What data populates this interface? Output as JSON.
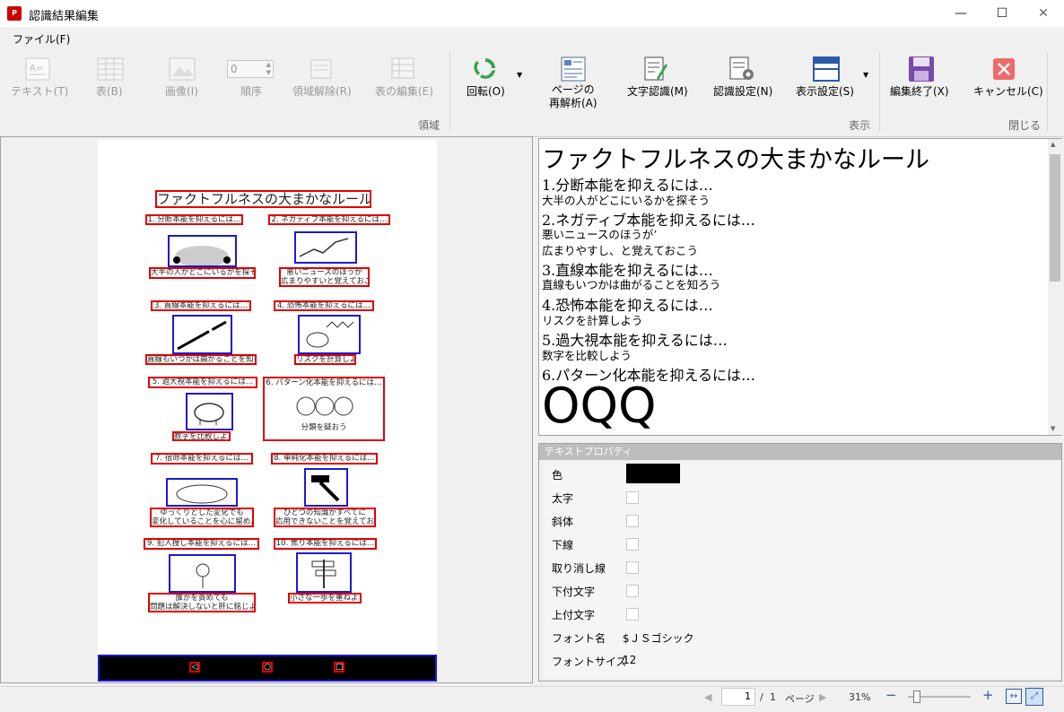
{
  "window": {
    "title": "認識結果編集",
    "minimize": "—",
    "maximize": "☐",
    "close": "✕"
  },
  "menu": {
    "file": "ファイル(F)"
  },
  "ribbon": {
    "text_btn": "テキスト(T)",
    "table_btn": "表(B)",
    "image_btn": "画像(I)",
    "order_value": "0",
    "order_btn": "順序",
    "region_clear_btn": "領域解除(R)",
    "table_edit_btn": "表の編集(E)",
    "group_region": "領域",
    "rotate_btn": "回転(O)",
    "reanalyze_btn_1": "ページの",
    "reanalyze_btn_2": "再解析(A)",
    "ocr_btn": "文字認識(M)",
    "ocr_settings_btn": "認識設定(N)",
    "display_settings_btn": "表示設定(S)",
    "group_display": "表示",
    "finish_btn": "編集終了(X)",
    "cancel_btn": "キャンセル(C)",
    "group_close": "閉じる"
  },
  "page_preview": {
    "title": "ファクトフルネスの大まかなルール",
    "items": [
      {
        "heading": "1. 分断本能を抑えるには…",
        "caption": "大半の人がどこにいるかを探そう"
      },
      {
        "heading": "2. ネガティブ本能を抑えるには…",
        "caption_1": "悪いニュースのほうが",
        "caption_2": "広まりやすいと覚えておこう"
      },
      {
        "heading": "3. 直線本能を抑えるには…",
        "caption": "直線もいつかは曲がることを知ろう"
      },
      {
        "heading": "4. 恐怖本能を抑えるには…",
        "caption": "リスクを計算しよう"
      },
      {
        "heading": "5. 過大視本能を抑えるには…",
        "caption": "数字を比較しよう"
      },
      {
        "heading": "6. パターン化本能を抑えるには…",
        "caption": "分類を疑おう"
      },
      {
        "heading": "7. 宿命本能を抑えるには…",
        "caption_1": "ゆっくりとした変化でも",
        "caption_2": "変化していることを心に留めよう"
      },
      {
        "heading": "8. 単純化本能を抑えるには…",
        "caption_1": "ひとつの知識がすべてに",
        "caption_2": "応用できないことを覚えておこう"
      },
      {
        "heading": "9. 犯人捜し本能を抑えるには…",
        "caption_1": "誰かを責めても",
        "caption_2": "問題は解決しないと肝に銘じよう"
      },
      {
        "heading": "10. 焦り本能を抑えるには…",
        "caption": "小さな一歩を重ねよう"
      }
    ]
  },
  "recognized_text": {
    "title": "ファクトフルネスの大まかなルール",
    "lines": [
      "1.分断本能を抑えるには…",
      "大半の人がどこにいるかを探そう",
      "2.ネガティブ本能を抑えるには…",
      "悪いニュースのほうが’",
      "広まりやすし、と覚えておこう",
      "3.直線本能を抑えるには…",
      "直線もいつかは曲がることを知ろう",
      "4.恐怖本能を抑えるには…",
      "リスクを計算しよう",
      "5.過大視本能を抑えるには…",
      "数字を比較しよう",
      "6.パターン化本能を抑えるには…"
    ],
    "big": "OQQ"
  },
  "properties": {
    "header": "テキストプロパティ",
    "color_label": "色",
    "color_value": "#000000",
    "bold": "太字",
    "italic": "斜体",
    "underline": "下線",
    "strikethrough": "取り消し線",
    "subscript": "下付文字",
    "superscript": "上付文字",
    "font_name_label": "フォント名",
    "font_name_value": "$ＪＳゴシック",
    "font_size_label": "フォントサイズ",
    "font_size_value": "12"
  },
  "status": {
    "page_current": "1",
    "page_sep": "/",
    "page_total": "1",
    "page_label": "ページ",
    "zoom": "31%",
    "zoom_level": 0.1
  }
}
